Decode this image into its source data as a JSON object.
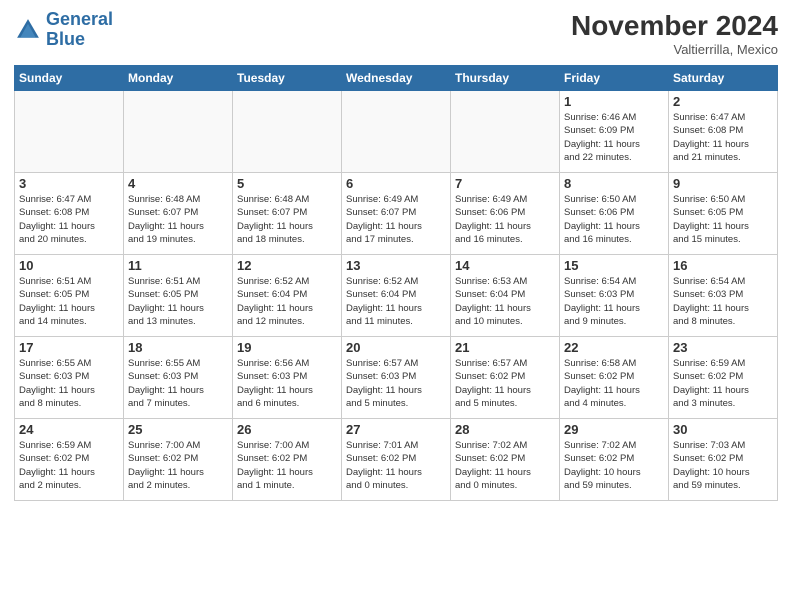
{
  "header": {
    "logo_general": "General",
    "logo_blue": "Blue",
    "month_title": "November 2024",
    "location": "Valtierrilla, Mexico"
  },
  "weekdays": [
    "Sunday",
    "Monday",
    "Tuesday",
    "Wednesday",
    "Thursday",
    "Friday",
    "Saturday"
  ],
  "weeks": [
    [
      {
        "day": "",
        "info": ""
      },
      {
        "day": "",
        "info": ""
      },
      {
        "day": "",
        "info": ""
      },
      {
        "day": "",
        "info": ""
      },
      {
        "day": "",
        "info": ""
      },
      {
        "day": "1",
        "info": "Sunrise: 6:46 AM\nSunset: 6:09 PM\nDaylight: 11 hours\nand 22 minutes."
      },
      {
        "day": "2",
        "info": "Sunrise: 6:47 AM\nSunset: 6:08 PM\nDaylight: 11 hours\nand 21 minutes."
      }
    ],
    [
      {
        "day": "3",
        "info": "Sunrise: 6:47 AM\nSunset: 6:08 PM\nDaylight: 11 hours\nand 20 minutes."
      },
      {
        "day": "4",
        "info": "Sunrise: 6:48 AM\nSunset: 6:07 PM\nDaylight: 11 hours\nand 19 minutes."
      },
      {
        "day": "5",
        "info": "Sunrise: 6:48 AM\nSunset: 6:07 PM\nDaylight: 11 hours\nand 18 minutes."
      },
      {
        "day": "6",
        "info": "Sunrise: 6:49 AM\nSunset: 6:07 PM\nDaylight: 11 hours\nand 17 minutes."
      },
      {
        "day": "7",
        "info": "Sunrise: 6:49 AM\nSunset: 6:06 PM\nDaylight: 11 hours\nand 16 minutes."
      },
      {
        "day": "8",
        "info": "Sunrise: 6:50 AM\nSunset: 6:06 PM\nDaylight: 11 hours\nand 16 minutes."
      },
      {
        "day": "9",
        "info": "Sunrise: 6:50 AM\nSunset: 6:05 PM\nDaylight: 11 hours\nand 15 minutes."
      }
    ],
    [
      {
        "day": "10",
        "info": "Sunrise: 6:51 AM\nSunset: 6:05 PM\nDaylight: 11 hours\nand 14 minutes."
      },
      {
        "day": "11",
        "info": "Sunrise: 6:51 AM\nSunset: 6:05 PM\nDaylight: 11 hours\nand 13 minutes."
      },
      {
        "day": "12",
        "info": "Sunrise: 6:52 AM\nSunset: 6:04 PM\nDaylight: 11 hours\nand 12 minutes."
      },
      {
        "day": "13",
        "info": "Sunrise: 6:52 AM\nSunset: 6:04 PM\nDaylight: 11 hours\nand 11 minutes."
      },
      {
        "day": "14",
        "info": "Sunrise: 6:53 AM\nSunset: 6:04 PM\nDaylight: 11 hours\nand 10 minutes."
      },
      {
        "day": "15",
        "info": "Sunrise: 6:54 AM\nSunset: 6:03 PM\nDaylight: 11 hours\nand 9 minutes."
      },
      {
        "day": "16",
        "info": "Sunrise: 6:54 AM\nSunset: 6:03 PM\nDaylight: 11 hours\nand 8 minutes."
      }
    ],
    [
      {
        "day": "17",
        "info": "Sunrise: 6:55 AM\nSunset: 6:03 PM\nDaylight: 11 hours\nand 8 minutes."
      },
      {
        "day": "18",
        "info": "Sunrise: 6:55 AM\nSunset: 6:03 PM\nDaylight: 11 hours\nand 7 minutes."
      },
      {
        "day": "19",
        "info": "Sunrise: 6:56 AM\nSunset: 6:03 PM\nDaylight: 11 hours\nand 6 minutes."
      },
      {
        "day": "20",
        "info": "Sunrise: 6:57 AM\nSunset: 6:03 PM\nDaylight: 11 hours\nand 5 minutes."
      },
      {
        "day": "21",
        "info": "Sunrise: 6:57 AM\nSunset: 6:02 PM\nDaylight: 11 hours\nand 5 minutes."
      },
      {
        "day": "22",
        "info": "Sunrise: 6:58 AM\nSunset: 6:02 PM\nDaylight: 11 hours\nand 4 minutes."
      },
      {
        "day": "23",
        "info": "Sunrise: 6:59 AM\nSunset: 6:02 PM\nDaylight: 11 hours\nand 3 minutes."
      }
    ],
    [
      {
        "day": "24",
        "info": "Sunrise: 6:59 AM\nSunset: 6:02 PM\nDaylight: 11 hours\nand 2 minutes."
      },
      {
        "day": "25",
        "info": "Sunrise: 7:00 AM\nSunset: 6:02 PM\nDaylight: 11 hours\nand 2 minutes."
      },
      {
        "day": "26",
        "info": "Sunrise: 7:00 AM\nSunset: 6:02 PM\nDaylight: 11 hours\nand 1 minute."
      },
      {
        "day": "27",
        "info": "Sunrise: 7:01 AM\nSunset: 6:02 PM\nDaylight: 11 hours\nand 0 minutes."
      },
      {
        "day": "28",
        "info": "Sunrise: 7:02 AM\nSunset: 6:02 PM\nDaylight: 11 hours\nand 0 minutes."
      },
      {
        "day": "29",
        "info": "Sunrise: 7:02 AM\nSunset: 6:02 PM\nDaylight: 10 hours\nand 59 minutes."
      },
      {
        "day": "30",
        "info": "Sunrise: 7:03 AM\nSunset: 6:02 PM\nDaylight: 10 hours\nand 59 minutes."
      }
    ]
  ]
}
